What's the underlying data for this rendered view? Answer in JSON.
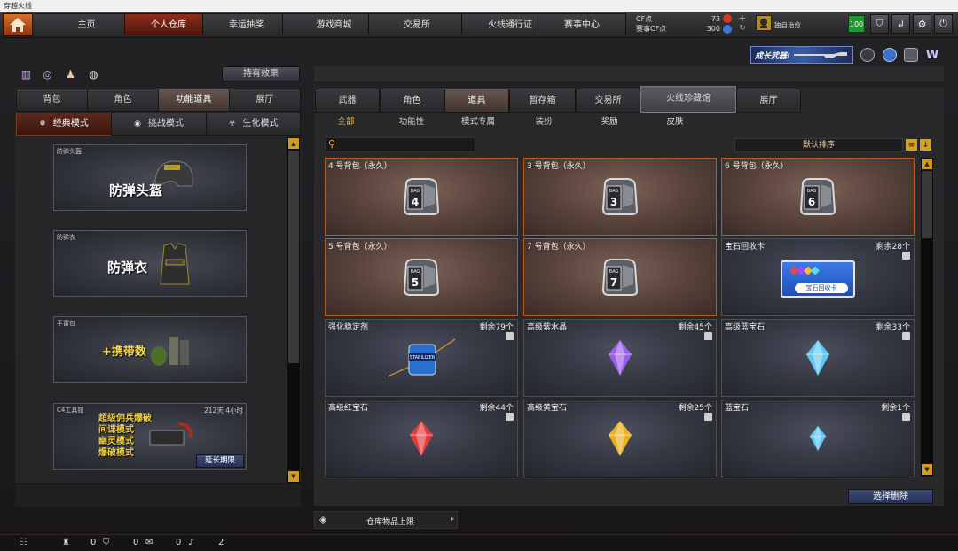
{
  "window": {
    "title": "穿越火线"
  },
  "nav": {
    "tabs": [
      {
        "label": "主页"
      },
      {
        "label": "个人仓库"
      },
      {
        "label": "幸运抽奖"
      },
      {
        "label": "游戏商城"
      },
      {
        "label": "交易所"
      },
      {
        "label": "火线通行证"
      },
      {
        "label": "赛事中心"
      }
    ],
    "cf_label": "CF点",
    "cf_value": "73",
    "event_cf_label": "赛事CF点",
    "event_cf_value": "300",
    "username": "独自治愈",
    "level": "100"
  },
  "banner": {
    "text": "成长武器!"
  },
  "left": {
    "effects_button": "持有效果",
    "tabs": [
      {
        "label": "背包"
      },
      {
        "label": "角色"
      },
      {
        "label": "功能道具"
      },
      {
        "label": "展厅"
      }
    ],
    "modes": [
      {
        "label": "经典模式"
      },
      {
        "label": "挑战模式"
      },
      {
        "label": "生化模式"
      }
    ],
    "items": [
      {
        "caption": "防弹头盔",
        "big": "防弹头盔"
      },
      {
        "caption": "防弹衣",
        "big": "防弹衣"
      },
      {
        "caption": "手雷包",
        "big": "+携带数"
      },
      {
        "caption": "C4工具钳",
        "time": "212天 4小时",
        "modes": [
          "超级佣兵爆破",
          "间谍模式",
          "幽灵模式",
          "爆破模式"
        ],
        "extend": "延长期限"
      }
    ]
  },
  "right": {
    "tabs": [
      {
        "label": "武器"
      },
      {
        "label": "角色"
      },
      {
        "label": "道具"
      },
      {
        "label": "暂存箱"
      },
      {
        "label": "交易所"
      },
      {
        "label": "火线珍藏馆"
      },
      {
        "label": "展厅"
      }
    ],
    "subtabs": [
      {
        "label": "全部"
      },
      {
        "label": "功能性"
      },
      {
        "label": "模式专属"
      },
      {
        "label": "装扮"
      },
      {
        "label": "奖励"
      },
      {
        "label": "皮肤"
      }
    ],
    "search": {
      "placeholder": ""
    },
    "sort": "默认排序",
    "items": [
      {
        "name": "4 号背包（永久）",
        "remain": "",
        "icon": "bag-4-icon",
        "bagnum": "4"
      },
      {
        "name": "3 号背包（永久）",
        "remain": "",
        "icon": "bag-3-icon",
        "bagnum": "3"
      },
      {
        "name": "6 号背包（永久）",
        "remain": "",
        "icon": "bag-6-icon",
        "bagnum": "6"
      },
      {
        "name": "5 号背包（永久）",
        "remain": "",
        "icon": "bag-5-icon",
        "bagnum": "5"
      },
      {
        "name": "7 号背包（永久）",
        "remain": "",
        "icon": "bag-7-icon",
        "bagnum": "7"
      },
      {
        "name": "宝石回收卡",
        "remain": "剩余28个",
        "icon": "gem-recycle-card-icon",
        "cardtext": "宝石回收卡"
      },
      {
        "name": "强化稳定剂",
        "remain": "剩余79个",
        "icon": "stabilizer-jar-icon"
      },
      {
        "name": "高级紫水晶",
        "remain": "剩余45个",
        "icon": "purple-crystal-icon",
        "color": "#9b5cf0"
      },
      {
        "name": "高级蓝宝石",
        "remain": "剩余33个",
        "icon": "blue-gem-icon",
        "color": "#5ec8f4"
      },
      {
        "name": "高级红宝石",
        "remain": "剩余44个",
        "icon": "red-gem-icon",
        "color": "#e43a3a"
      },
      {
        "name": "高级黄宝石",
        "remain": "剩余25个",
        "icon": "yellow-gem-icon",
        "color": "#e8b21e"
      },
      {
        "name": "蓝宝石",
        "remain": "剩余1个",
        "icon": "small-blue-gem-icon",
        "color": "#5ec8f4"
      }
    ],
    "delete_button": "选择删除",
    "capacity": "仓库物品上限"
  },
  "status": {
    "a": "0",
    "b": "0",
    "c": "0",
    "d": "2"
  }
}
